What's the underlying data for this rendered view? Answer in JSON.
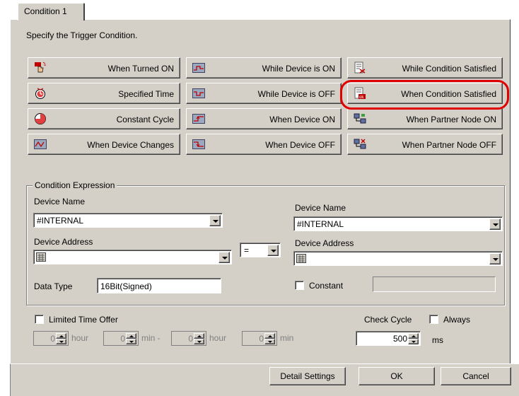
{
  "tab": {
    "label": "Condition 1"
  },
  "instruction": "Specify the Trigger Condition.",
  "trigger_buttons": [
    {
      "label": "When Turned ON",
      "icon": "hand-click-icon"
    },
    {
      "label": "While Device is ON",
      "icon": "device-on-graph-icon"
    },
    {
      "label": "While Condition Satisfied",
      "icon": "condition-satisfied-icon"
    },
    {
      "label": "Specified Time",
      "icon": "alarm-clock-icon"
    },
    {
      "label": "While Device is OFF",
      "icon": "device-off-graph-icon"
    },
    {
      "label": "When Condition Satisfied",
      "icon": "condition-ok-icon"
    },
    {
      "label": "Constant Cycle",
      "icon": "cycle-clock-icon"
    },
    {
      "label": "When Device ON",
      "icon": "rising-edge-icon"
    },
    {
      "label": "When Partner Node ON",
      "icon": "partner-node-on-icon"
    },
    {
      "label": "When Device Changes",
      "icon": "device-change-icon"
    },
    {
      "label": "When Device OFF",
      "icon": "falling-edge-icon"
    },
    {
      "label": "When Partner Node OFF",
      "icon": "partner-node-off-icon"
    }
  ],
  "expression": {
    "group_label": "Condition Expression",
    "left_device_name_label": "Device Name",
    "left_device_name_value": "#INTERNAL",
    "left_device_address_label": "Device Address",
    "left_device_address_value": "",
    "operator_value": "=",
    "right_device_name_label": "Device Name",
    "right_device_name_value": "#INTERNAL",
    "right_device_address_label": "Device Address",
    "right_device_address_value": "",
    "data_type_label": "Data Type",
    "data_type_value": "16Bit(Signed)",
    "constant_label": "Constant",
    "constant_value": ""
  },
  "limited": {
    "label": "Limited Time Offer",
    "start_hour": "0",
    "hour_label_1": "hour",
    "start_min": "0",
    "min_dash_label": "min -",
    "end_hour": "0",
    "hour_label_2": "hour",
    "end_min": "0",
    "min_label": "min"
  },
  "check_cycle": {
    "label": "Check Cycle",
    "always_label": "Always",
    "value": "500",
    "unit": "ms"
  },
  "footer": {
    "detail_settings": "Detail Settings",
    "ok": "OK",
    "cancel": "Cancel"
  },
  "colors": {
    "dialog_face": "#d4d0c8",
    "highlight_ring": "#e00000"
  }
}
